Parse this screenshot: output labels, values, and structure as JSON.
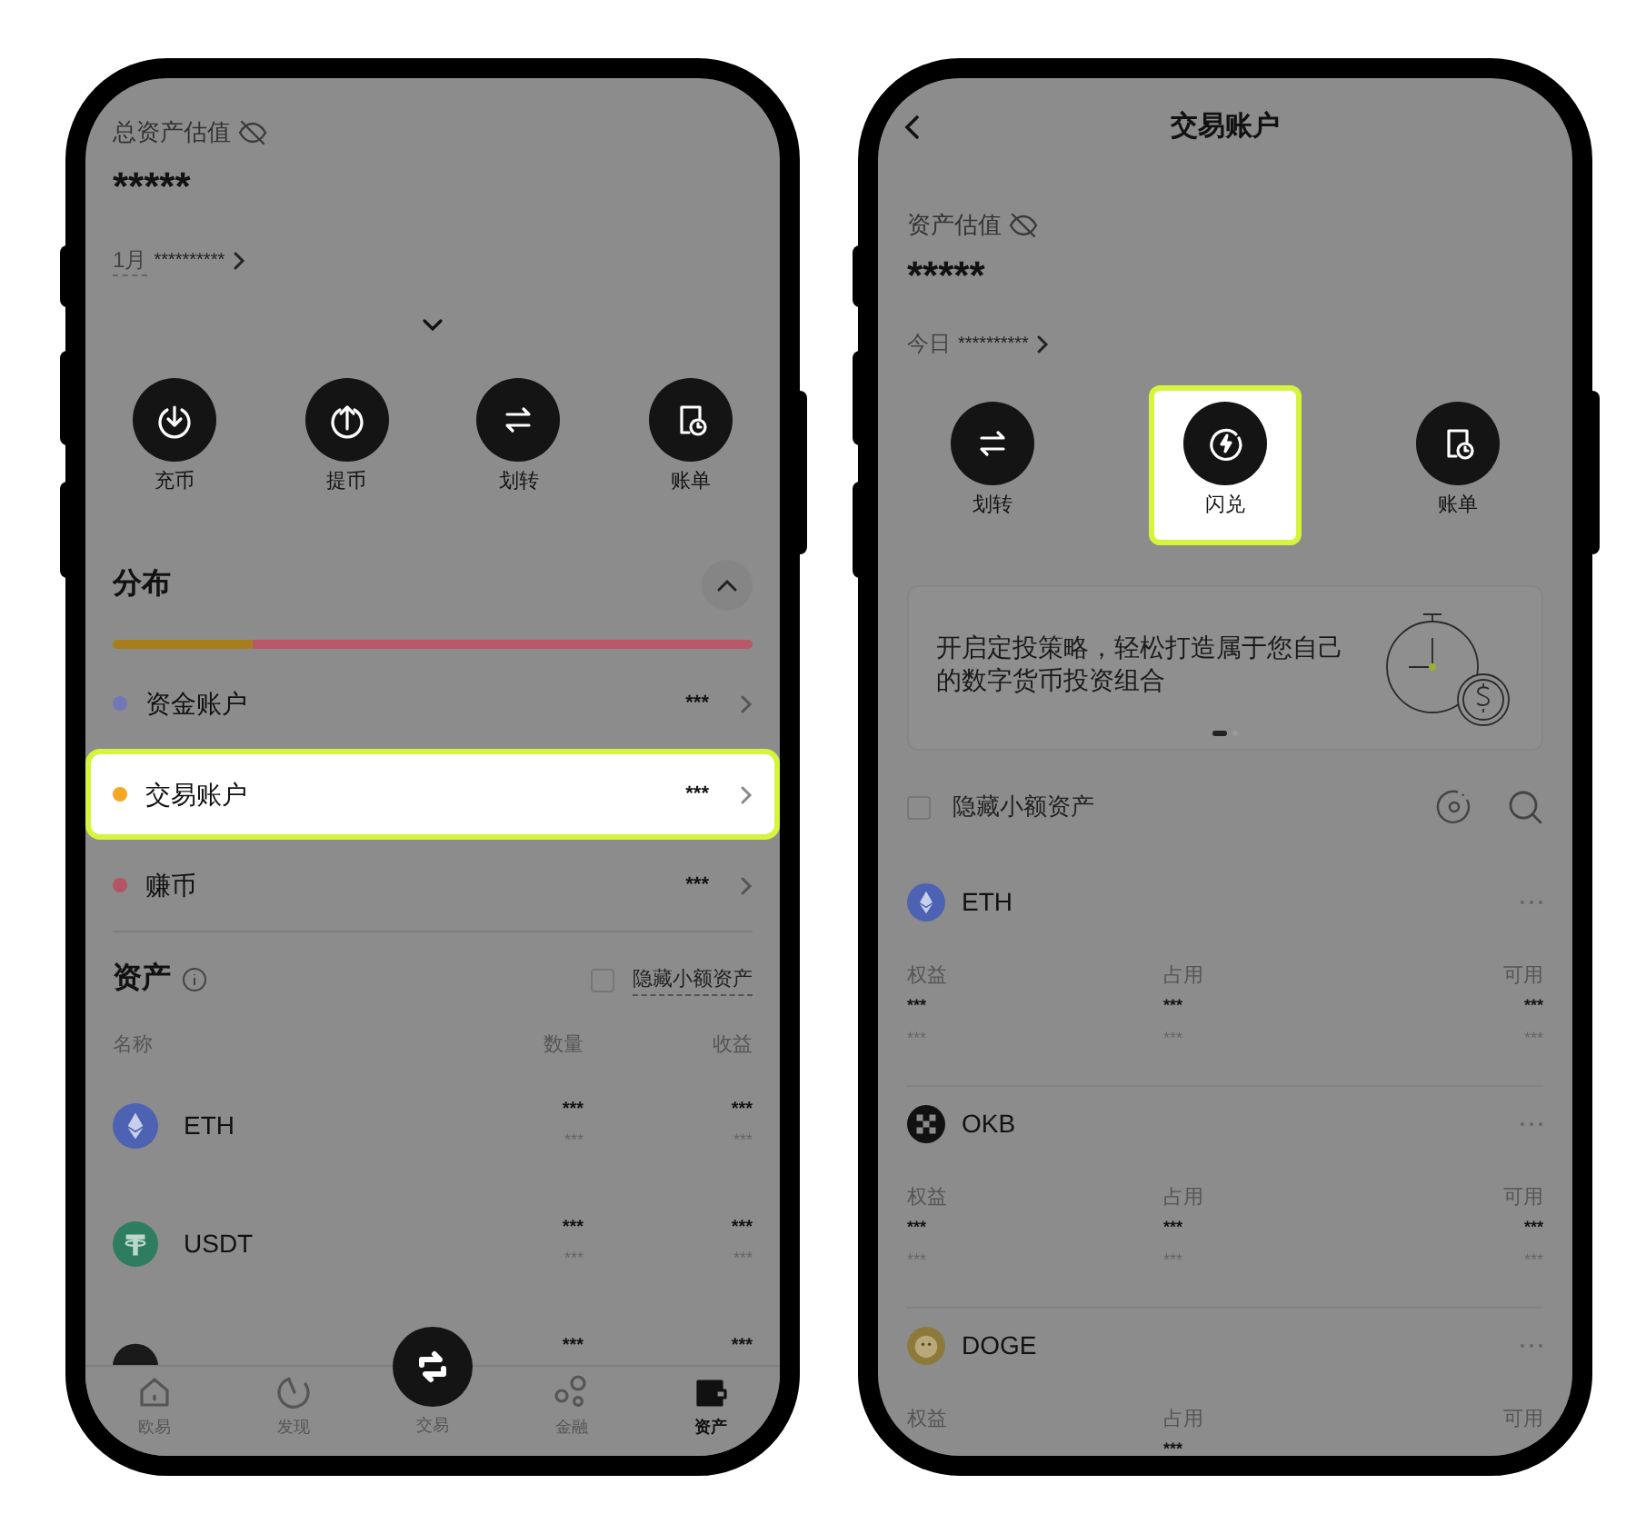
{
  "left_screen": {
    "total_label": "总资产估值",
    "total_value": "*****",
    "period_label": "1月",
    "period_value": "**********",
    "actions": [
      {
        "label": "充币",
        "kind": "deposit",
        "highlighted": false
      },
      {
        "label": "提币",
        "kind": "withdraw",
        "highlighted": false
      },
      {
        "label": "划转",
        "kind": "transfer",
        "highlighted": false
      },
      {
        "label": "账单",
        "kind": "bill",
        "highlighted": false
      }
    ],
    "distribution": {
      "title": "分布",
      "bar": [
        {
          "color": "#a87d1c",
          "level": 0.22
        },
        {
          "color": "#b85868",
          "level": 0.78
        }
      ],
      "accounts": [
        {
          "name": "资金账户",
          "value": "***",
          "color": "#7276b6",
          "highlighted": false
        },
        {
          "name": "交易账户",
          "value": "***",
          "color": "#f5a623",
          "highlighted": true
        },
        {
          "name": "赚币",
          "value": "***",
          "color": "#b35563",
          "highlighted": false
        }
      ]
    },
    "assets": {
      "title": "资产",
      "hide_small": {
        "label": "隐藏小额资产",
        "checked": false
      },
      "columns": [
        "名称",
        "数量",
        "收益"
      ],
      "rows": [
        {
          "name": "ETH",
          "kind": "eth",
          "quantity": "***",
          "quantity_sub": "***",
          "income": "***",
          "income_sub": "***"
        },
        {
          "name": "USDT",
          "kind": "usdt",
          "quantity": "***",
          "quantity_sub": "***",
          "income": "***",
          "income_sub": "***"
        },
        {
          "kind": "dark",
          "quantity": "***",
          "income": "***"
        }
      ]
    },
    "nav": [
      {
        "label": "欧易",
        "kind": "home",
        "selected": false
      },
      {
        "label": "发现",
        "kind": "discover",
        "selected": false
      },
      {
        "label": "交易",
        "kind": "trade",
        "selected": false
      },
      {
        "label": "金融",
        "kind": "finance",
        "selected": false
      },
      {
        "label": "资产",
        "kind": "wallet",
        "selected": true
      }
    ]
  },
  "right_screen": {
    "title": "交易账户",
    "value_label": "资产估值",
    "value": "*****",
    "today_label": "今日",
    "today_value": "**********",
    "actions": [
      {
        "label": "划转",
        "kind": "transfer",
        "highlighted": false
      },
      {
        "label": "闪兑",
        "kind": "flash",
        "highlighted": true
      },
      {
        "label": "账单",
        "kind": "bill",
        "highlighted": false
      }
    ],
    "banner": {
      "text": "开启定投策略，轻松打造属于您自己的数字货币投资组合",
      "pages": [
        {
          "selected": true
        },
        {
          "selected": false
        }
      ]
    },
    "hide_small": {
      "label": "隐藏小额资产",
      "checked": false
    },
    "coins": [
      {
        "name": "ETH",
        "kind": "eth",
        "columns": [
          {
            "label": "权益",
            "value": "***",
            "sub": "***"
          },
          {
            "label": "占用",
            "value": "***",
            "sub": "***"
          },
          {
            "label": "可用",
            "value": "***",
            "sub": "***"
          }
        ]
      },
      {
        "name": "OKB",
        "kind": "okb",
        "columns": [
          {
            "label": "权益",
            "value": "***",
            "sub": "***"
          },
          {
            "label": "占用",
            "value": "***",
            "sub": "***"
          },
          {
            "label": "可用",
            "value": "***",
            "sub": "***"
          }
        ]
      },
      {
        "name": "DOGE",
        "kind": "doge",
        "columns": [
          {
            "label": "权益"
          },
          {
            "label": "占用",
            "value": "***"
          },
          {
            "label": "可用"
          }
        ]
      }
    ]
  }
}
